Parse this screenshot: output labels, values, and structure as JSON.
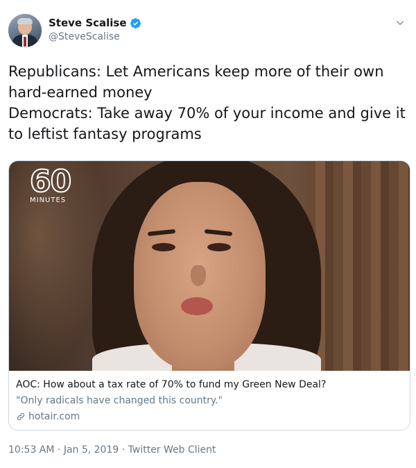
{
  "author": {
    "display_name": "Steve Scalise",
    "handle": "@SteveScalise"
  },
  "icons": {
    "verified": "verified-badge-icon",
    "menu": "chevron-down-icon",
    "link": "link-icon"
  },
  "colors": {
    "verified_blue": "#1da1f2",
    "secondary_text": "#657786",
    "primary_text": "#14171a",
    "border": "#ccd6dd"
  },
  "tweet": {
    "lines": [
      "Republicans: Let Americans keep more of their own",
      "hard-earned money",
      "Democrats: Take away 70% of your income and give it",
      "to leftist fantasy programs"
    ]
  },
  "card": {
    "logo_number": "60",
    "logo_word": "MINUTES",
    "title": "AOC: How about a tax rate of 70% to fund my Green New Deal?",
    "description": "\"Only radicals have changed this country.\"",
    "domain": "hotair.com"
  },
  "meta": {
    "time": "10:53 AM",
    "separator": " · ",
    "date": "Jan 5, 2019",
    "source": "Twitter Web Client"
  }
}
